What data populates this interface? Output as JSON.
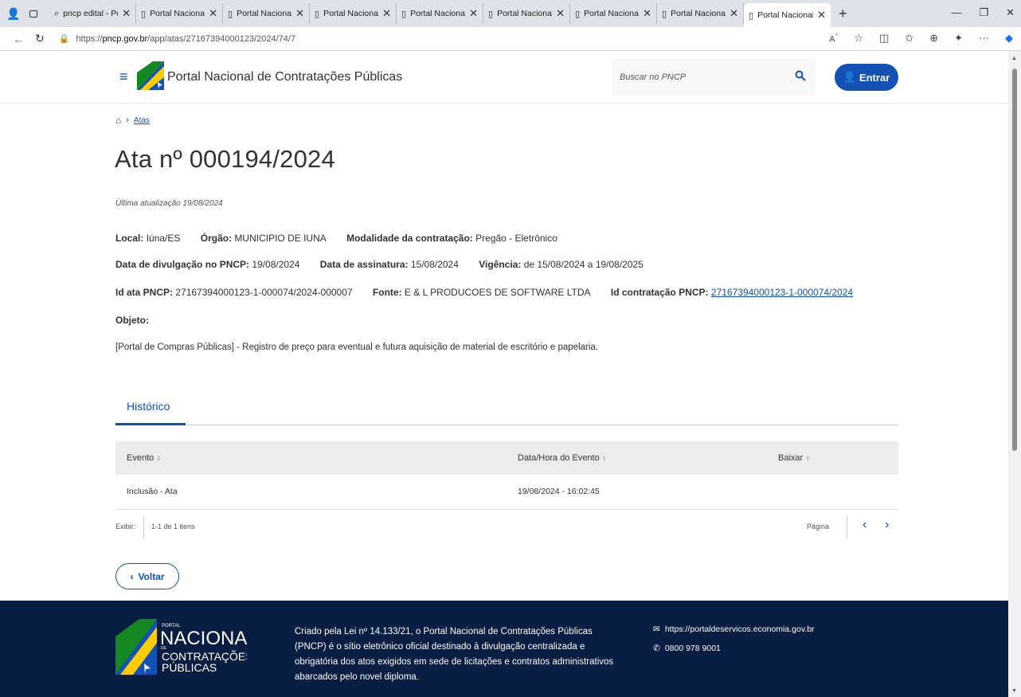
{
  "browser": {
    "tabs": [
      {
        "label": "pncp edital - Pesquisa",
        "icon": "search-icon"
      },
      {
        "label": "Portal Nacional de Co",
        "icon": "page-icon"
      },
      {
        "label": "Portal Nacional de Co",
        "icon": "page-icon"
      },
      {
        "label": "Portal Nacional de Co",
        "icon": "page-icon"
      },
      {
        "label": "Portal Nacional de Co",
        "icon": "page-icon"
      },
      {
        "label": "Portal Nacional de Co",
        "icon": "page-icon"
      },
      {
        "label": "Portal Nacional de Co",
        "icon": "page-icon"
      },
      {
        "label": "Portal Nacional de Co",
        "icon": "page-icon"
      },
      {
        "label": "Portal Nacional de Co",
        "icon": "page-icon"
      }
    ],
    "url_prefix": "https://",
    "url_host": "pncp.gov.br",
    "url_path": "/app/atas/27167394000123/2024/74/7"
  },
  "header": {
    "site_title": "Portal Nacional de Contratações Públicas",
    "search_placeholder": "Buscar no PNCP",
    "login_label": "Entrar"
  },
  "breadcrumb": {
    "item": "Atas"
  },
  "ata": {
    "title": "Ata nº 000194/2024",
    "updated": "Última atualização 19/08/2024",
    "local_label": "Local:",
    "local_value": "Iúna/ES",
    "orgao_label": "Órgão:",
    "orgao_value": "MUNICIPIO DE IUNA",
    "modalidade_label": "Modalidade da contratação:",
    "modalidade_value": "Pregão - Eletrônico",
    "divulgacao_label": "Data de divulgação no PNCP:",
    "divulgacao_value": "19/08/2024",
    "assinatura_label": "Data de assinatura:",
    "assinatura_value": "15/08/2024",
    "vigencia_label": "Vigência:",
    "vigencia_value": "de 15/08/2024 a 19/08/2025",
    "id_ata_label": "Id ata PNCP:",
    "id_ata_value": "27167394000123-1-000074/2024-000007",
    "fonte_label": "Fonte:",
    "fonte_value": "E & L PRODUCOES DE SOFTWARE LTDA",
    "id_contratacao_label": "Id contratação PNCP:",
    "id_contratacao_value": "27167394000123-1-000074/2024",
    "objeto_label": "Objeto:",
    "objeto_value": "[Portal de Compras Públicas] - Registro de preço para eventual e futura aquisição de material de escritório e papelaria."
  },
  "historico": {
    "tab_label": "Histórico",
    "columns": [
      "Evento",
      "Data/Hora do Evento",
      "Baixar"
    ],
    "rows": [
      {
        "evento": "Inclusão - Ata",
        "data_hora": "19/08/2024 - 16:02:45"
      }
    ],
    "exibir_label": "Exibir:",
    "count_text": "1-1 de 1 itens",
    "pagina_label": "Página"
  },
  "back_label": "Voltar",
  "footer": {
    "logo_portal": "PORTAL",
    "logo_nacional": "NACIONAL",
    "logo_de": "DE",
    "logo_contratacoes": "CONTRATAÇÕES",
    "logo_publicas": "PÚBLICAS",
    "description": "Criado pela Lei nº 14.133/21, o Portal Nacional de Contratações Públicas (PNCP) é o sítio eletrônico oficial destinado à divulgação centralizada e obrigatória dos atos exigidos em sede de licitações e contratos administrativos abarcados pelo novel diploma.",
    "contact_url": "https://portaldeservicos.economia.gov.br",
    "contact_phone": "0800 978 9001"
  },
  "colors": {
    "primary": "#1351b4",
    "footer_bg": "#071d41",
    "logo_green": "#168821",
    "logo_yellow": "#ffcd07"
  }
}
